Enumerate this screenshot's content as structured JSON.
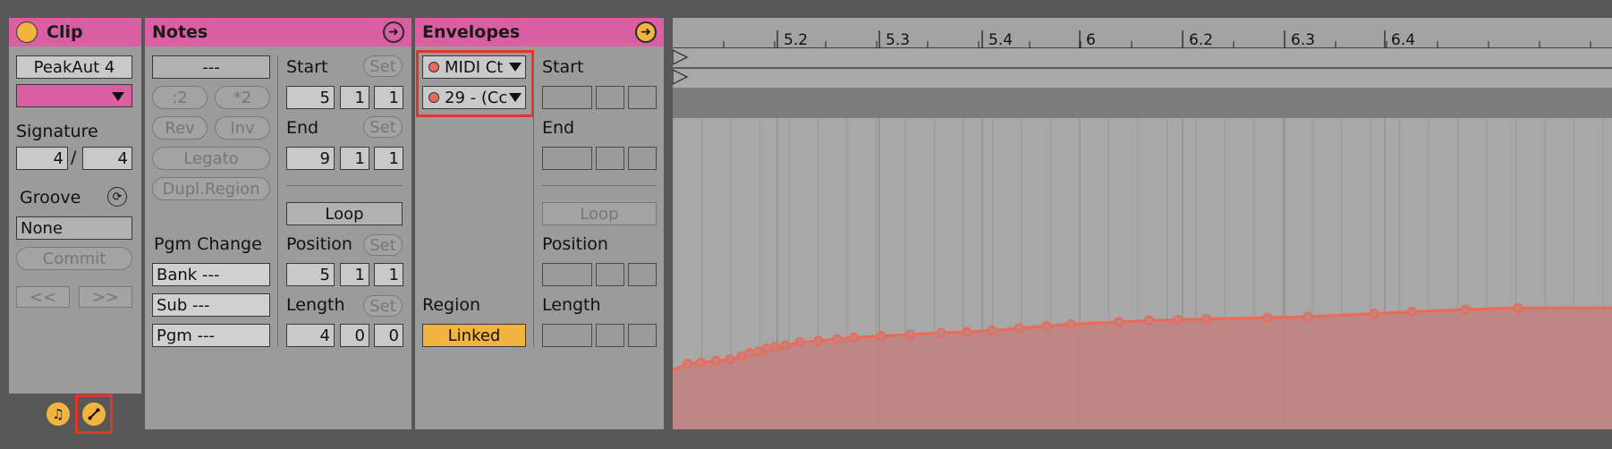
{
  "clip": {
    "title": "Clip",
    "name": "PeakAut 4",
    "signature_label": "Signature",
    "sig_num": "4",
    "sig_slash": "/",
    "sig_den": "4",
    "groove_label": "Groove",
    "groove_value": "None",
    "commit_label": "Commit",
    "prev_label": "<<",
    "next_label": ">>"
  },
  "notes": {
    "title": "Notes",
    "dash_field": "---",
    "half_label": ":2",
    "double_label": "*2",
    "rev_label": "Rev",
    "inv_label": "Inv",
    "legato_label": "Legato",
    "dupl_label": "Dupl.Region",
    "pgm_change_label": "Pgm Change",
    "bank_value": "Bank ---",
    "sub_value": "Sub ---",
    "pgm_value": "Pgm ---",
    "start_label": "Start",
    "end_label": "End",
    "set_label": "Set",
    "start_values": [
      "5",
      "1",
      "1"
    ],
    "end_values": [
      "9",
      "1",
      "1"
    ],
    "loop_label": "Loop",
    "position_label": "Position",
    "position_values": [
      "5",
      "1",
      "1"
    ],
    "length_label": "Length",
    "length_values": [
      "4",
      "0",
      "0"
    ]
  },
  "envelopes": {
    "title": "Envelopes",
    "device_chooser": "MIDI Ct",
    "control_chooser": "29 - (Cc",
    "start_label": "Start",
    "end_label": "End",
    "loop_label": "Loop",
    "position_label": "Position",
    "length_label": "Length",
    "region_label": "Region",
    "linked_label": "Linked"
  },
  "ruler": {
    "ticks": [
      "5.2",
      "5.3",
      "5.4",
      "6",
      "6.2",
      "6.3",
      "6.4"
    ]
  },
  "envelope_curve": {
    "color": "#ec6a56",
    "fill": "#c08484",
    "breakpoints": [
      [
        0.0,
        0.19
      ],
      [
        0.016,
        0.21
      ],
      [
        0.03,
        0.215
      ],
      [
        0.046,
        0.22
      ],
      [
        0.061,
        0.225
      ],
      [
        0.073,
        0.235
      ],
      [
        0.082,
        0.245
      ],
      [
        0.091,
        0.25
      ],
      [
        0.1,
        0.26
      ],
      [
        0.109,
        0.265
      ],
      [
        0.12,
        0.27
      ],
      [
        0.135,
        0.28
      ],
      [
        0.155,
        0.285
      ],
      [
        0.175,
        0.29
      ],
      [
        0.193,
        0.295
      ],
      [
        0.222,
        0.3
      ],
      [
        0.253,
        0.305
      ],
      [
        0.286,
        0.31
      ],
      [
        0.313,
        0.313
      ],
      [
        0.34,
        0.318
      ],
      [
        0.369,
        0.325
      ],
      [
        0.398,
        0.332
      ],
      [
        0.424,
        0.338
      ],
      [
        0.475,
        0.345
      ],
      [
        0.507,
        0.35
      ],
      [
        0.538,
        0.352
      ],
      [
        0.568,
        0.355
      ],
      [
        0.633,
        0.358
      ],
      [
        0.676,
        0.362
      ],
      [
        0.747,
        0.372
      ],
      [
        0.787,
        0.378
      ],
      [
        0.844,
        0.385
      ],
      [
        0.9,
        0.39
      ],
      [
        1.0,
        0.39
      ]
    ]
  },
  "footer": {
    "notes_icon": "music-note-icon",
    "envelope_icon": "envelope-icon"
  }
}
